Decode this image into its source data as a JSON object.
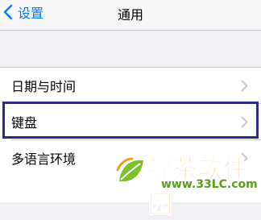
{
  "navbar": {
    "back_label": "设置",
    "title": "通用",
    "accent": "#007aff"
  },
  "list": {
    "items": [
      {
        "label": "日期与时间"
      },
      {
        "label": "键盘"
      },
      {
        "label": "多语言环境"
      }
    ]
  },
  "annotation": {
    "highlight_color": "#2b2a8a"
  },
  "watermark": {
    "name": "绿茶软件园",
    "url": "www.33LC.com"
  },
  "icons": {
    "back": "chevron-left-icon",
    "disclosure": "chevron-right-icon",
    "watermark_logo": "leaf-logo-icon"
  }
}
